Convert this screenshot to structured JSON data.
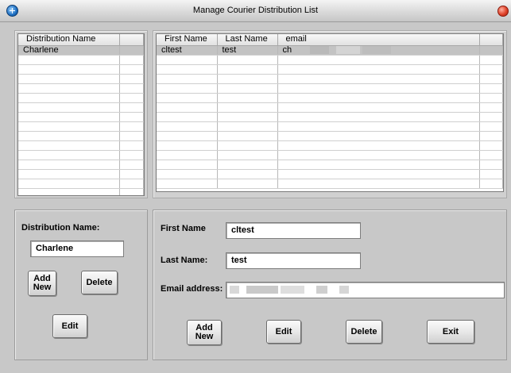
{
  "window": {
    "title": "Manage Courier Distribution List"
  },
  "distribution_list": {
    "columns": [
      "Distribution Name",
      ""
    ],
    "rows": [
      [
        "Charlene",
        ""
      ]
    ]
  },
  "contacts_list": {
    "columns": [
      "First Name",
      "Last Name",
      "email",
      ""
    ],
    "rows": [
      [
        "cltest",
        "test",
        "ch",
        ""
      ]
    ]
  },
  "distribution_form": {
    "name_label": "Distribution Name:",
    "name_value": "Charlene",
    "add_new_label": "Add\nNew",
    "delete_label": "Delete",
    "edit_label": "Edit"
  },
  "contact_form": {
    "first_name_label": "First Name",
    "first_name_value": "cltest",
    "last_name_label": "Last Name:",
    "last_name_value": "test",
    "email_label": "Email address:",
    "email_value": "",
    "add_new_label": "Add\nNew",
    "edit_label": "Edit",
    "delete_label": "Delete",
    "exit_label": "Exit"
  }
}
